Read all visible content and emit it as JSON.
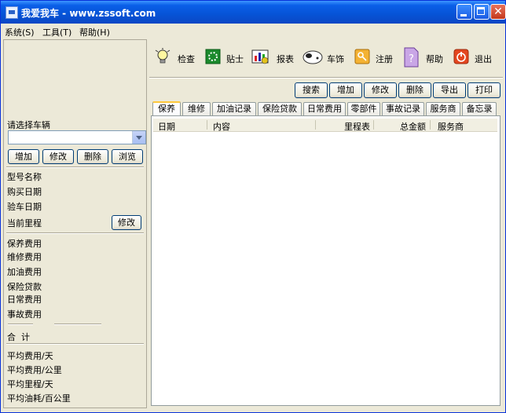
{
  "window": {
    "title": "我爱我车 - www.zssoft.com"
  },
  "menu": [
    "系统(S)",
    "工具(T)",
    "帮助(H)"
  ],
  "toolbar": [
    {
      "label": "检查",
      "icon": "lightbulb-icon"
    },
    {
      "label": "贴士",
      "icon": "tips-icon"
    },
    {
      "label": "报表",
      "icon": "report-icon"
    },
    {
      "label": "车饰",
      "icon": "car-decoration-icon"
    },
    {
      "label": "注册",
      "icon": "key-icon"
    },
    {
      "label": "帮助",
      "icon": "help-icon"
    },
    {
      "label": "退出",
      "icon": "power-icon"
    }
  ],
  "record_actions": [
    "搜索",
    "增加",
    "修改",
    "删除",
    "导出",
    "打印"
  ],
  "tabs": [
    "保养",
    "维修",
    "加油记录",
    "保险贷款",
    "日常费用",
    "零部件",
    "事故记录",
    "服务商",
    "备忘录"
  ],
  "table_headers": [
    "日期",
    "内容",
    "里程表",
    "总金额",
    "服务商"
  ],
  "left": {
    "select_label": "请选择车辆",
    "vehicle_buttons": [
      "增加",
      "修改",
      "删除",
      "浏览"
    ],
    "info_labels": [
      "型号名称",
      "购买日期",
      "验车日期",
      "当前里程"
    ],
    "mileage_edit": "修改",
    "cost_labels": [
      "保养费用",
      "维修费用",
      "加油费用",
      "保险贷款",
      "日常费用",
      "事故费用"
    ],
    "total_label": "合  计",
    "avg_labels": [
      "平均费用/天",
      "平均费用/公里",
      "平均里程/天",
      "平均油耗/百公里"
    ]
  }
}
